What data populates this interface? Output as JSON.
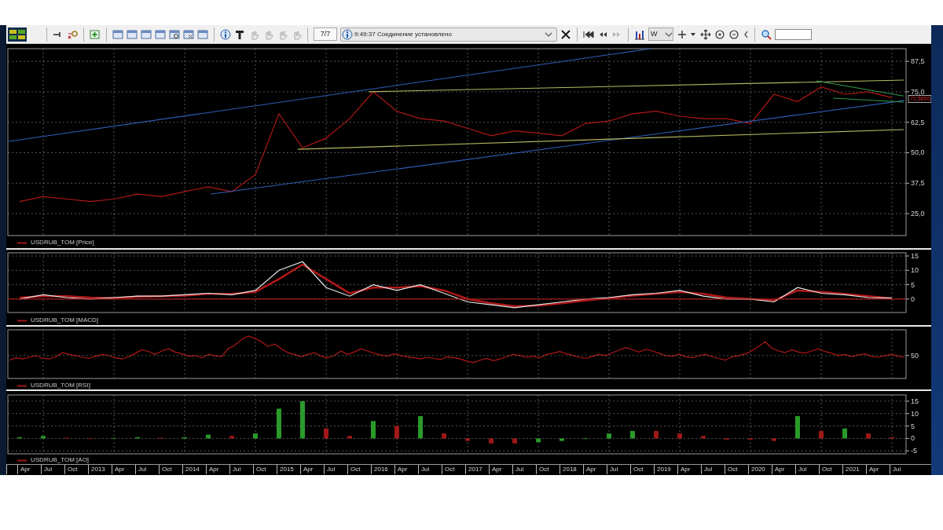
{
  "toolbar": {
    "counter": "7/7",
    "status_message": "9:49:37 Соединение установлено",
    "interval": "W"
  },
  "price_panel": {
    "legend": "USDRUB_TOM [Price]",
    "last_price_label": "72,5850",
    "chart_data": {
      "type": "line",
      "grid": true,
      "series": [
        {
          "color": "#b01818",
          "values": [
            30,
            32,
            31,
            30,
            31,
            33,
            32,
            34,
            36,
            34,
            41,
            66,
            52,
            56,
            64,
            75,
            67,
            64,
            63,
            60,
            57,
            59,
            58,
            57,
            62,
            63,
            66,
            67,
            65,
            64,
            64,
            62,
            74,
            71,
            77,
            74,
            75,
            72.6
          ]
        }
      ],
      "ylim": [
        16,
        92.7
      ],
      "yticks": [
        {
          "value": 25,
          "label": "25,0"
        },
        {
          "value": 37.5,
          "label": "37,5"
        },
        {
          "value": 50,
          "label": "50,0"
        },
        {
          "value": 62.5,
          "label": "62,5"
        },
        {
          "value": 75,
          "label": "75,0"
        },
        {
          "value": 87.5,
          "label": "87,5"
        }
      ]
    }
  },
  "macd_panel": {
    "legend": "USDRUB_TOM [MACD]",
    "chart_data": {
      "type": "line",
      "grid": true,
      "series": [
        {
          "color": "#e8e8e8",
          "values": [
            0,
            1.5,
            0.5,
            0,
            0.5,
            1,
            1,
            1.5,
            2,
            1.5,
            3,
            10,
            13,
            4,
            1,
            5,
            3,
            5,
            2,
            -1,
            -2,
            -3,
            -2,
            -1,
            0,
            0.5,
            1.5,
            2,
            3,
            1,
            0,
            0,
            -1,
            4,
            2,
            1.5,
            0.5,
            0.3
          ]
        },
        {
          "color": "#b01818",
          "values": [
            0.5,
            1,
            1,
            0.5,
            0.3,
            0.8,
            1,
            1.2,
            1.8,
            1.8,
            2.5,
            7,
            12,
            7,
            2,
            4,
            4,
            4.5,
            3,
            0,
            -1.5,
            -2.5,
            -2.3,
            -1.5,
            -0.5,
            0.3,
            1.2,
            1.8,
            2.5,
            1.8,
            0.5,
            0,
            -0.5,
            3,
            2.5,
            1.8,
            1,
            0.2
          ]
        }
      ],
      "ylim": [
        -4.7,
        16.1
      ],
      "yticks": [
        0,
        5,
        10,
        15
      ]
    }
  },
  "rsi_panel": {
    "legend": "USDRUB_TOM [RSI]",
    "tick_label": "50"
  },
  "ao_panel": {
    "legend": "USDRUB_TOM [AO]",
    "chart_data": {
      "type": "bar",
      "grid": true,
      "series": [
        {
          "color": "#2a9a2a",
          "values": [
            0.5,
            1,
            null,
            null,
            0.2,
            0.5,
            null,
            0.5,
            1.5,
            null,
            2,
            12,
            15,
            null,
            null,
            7,
            null,
            9,
            null,
            null,
            null,
            null,
            -1.5,
            -1,
            0,
            2,
            3,
            null,
            null,
            null,
            null,
            null,
            null,
            9,
            null,
            4,
            null,
            null
          ]
        },
        {
          "color": "#a01818",
          "values": [
            null,
            null,
            0.3,
            0,
            null,
            null,
            0.3,
            null,
            null,
            1,
            null,
            null,
            null,
            4,
            1,
            null,
            5,
            null,
            2,
            -1,
            -2,
            -2,
            null,
            null,
            null,
            null,
            null,
            3,
            2,
            1,
            -0.5,
            -0.5,
            -1,
            null,
            3,
            null,
            2,
            0.5
          ]
        }
      ],
      "ylim": [
        -6.2,
        17.5
      ],
      "yticks": [
        -5,
        0,
        5,
        10,
        15
      ]
    }
  },
  "time_axis": {
    "labels": [
      "Apr",
      "Jul",
      "Oct",
      "2013",
      "Apr",
      "Jul",
      "Oct",
      "2014",
      "Apr",
      "Jul",
      "Oct",
      "2015",
      "Apr",
      "Jul",
      "Oct",
      "2016",
      "Apr",
      "Jul",
      "Oct",
      "2017",
      "Apr",
      "Jul",
      "Oct",
      "2018",
      "Apr",
      "Jul",
      "Oct",
      "2019",
      "Apr",
      "Jul",
      "Oct",
      "2020",
      "Apr",
      "Jul",
      "Oct",
      "2021",
      "Apr",
      "Jul"
    ]
  }
}
